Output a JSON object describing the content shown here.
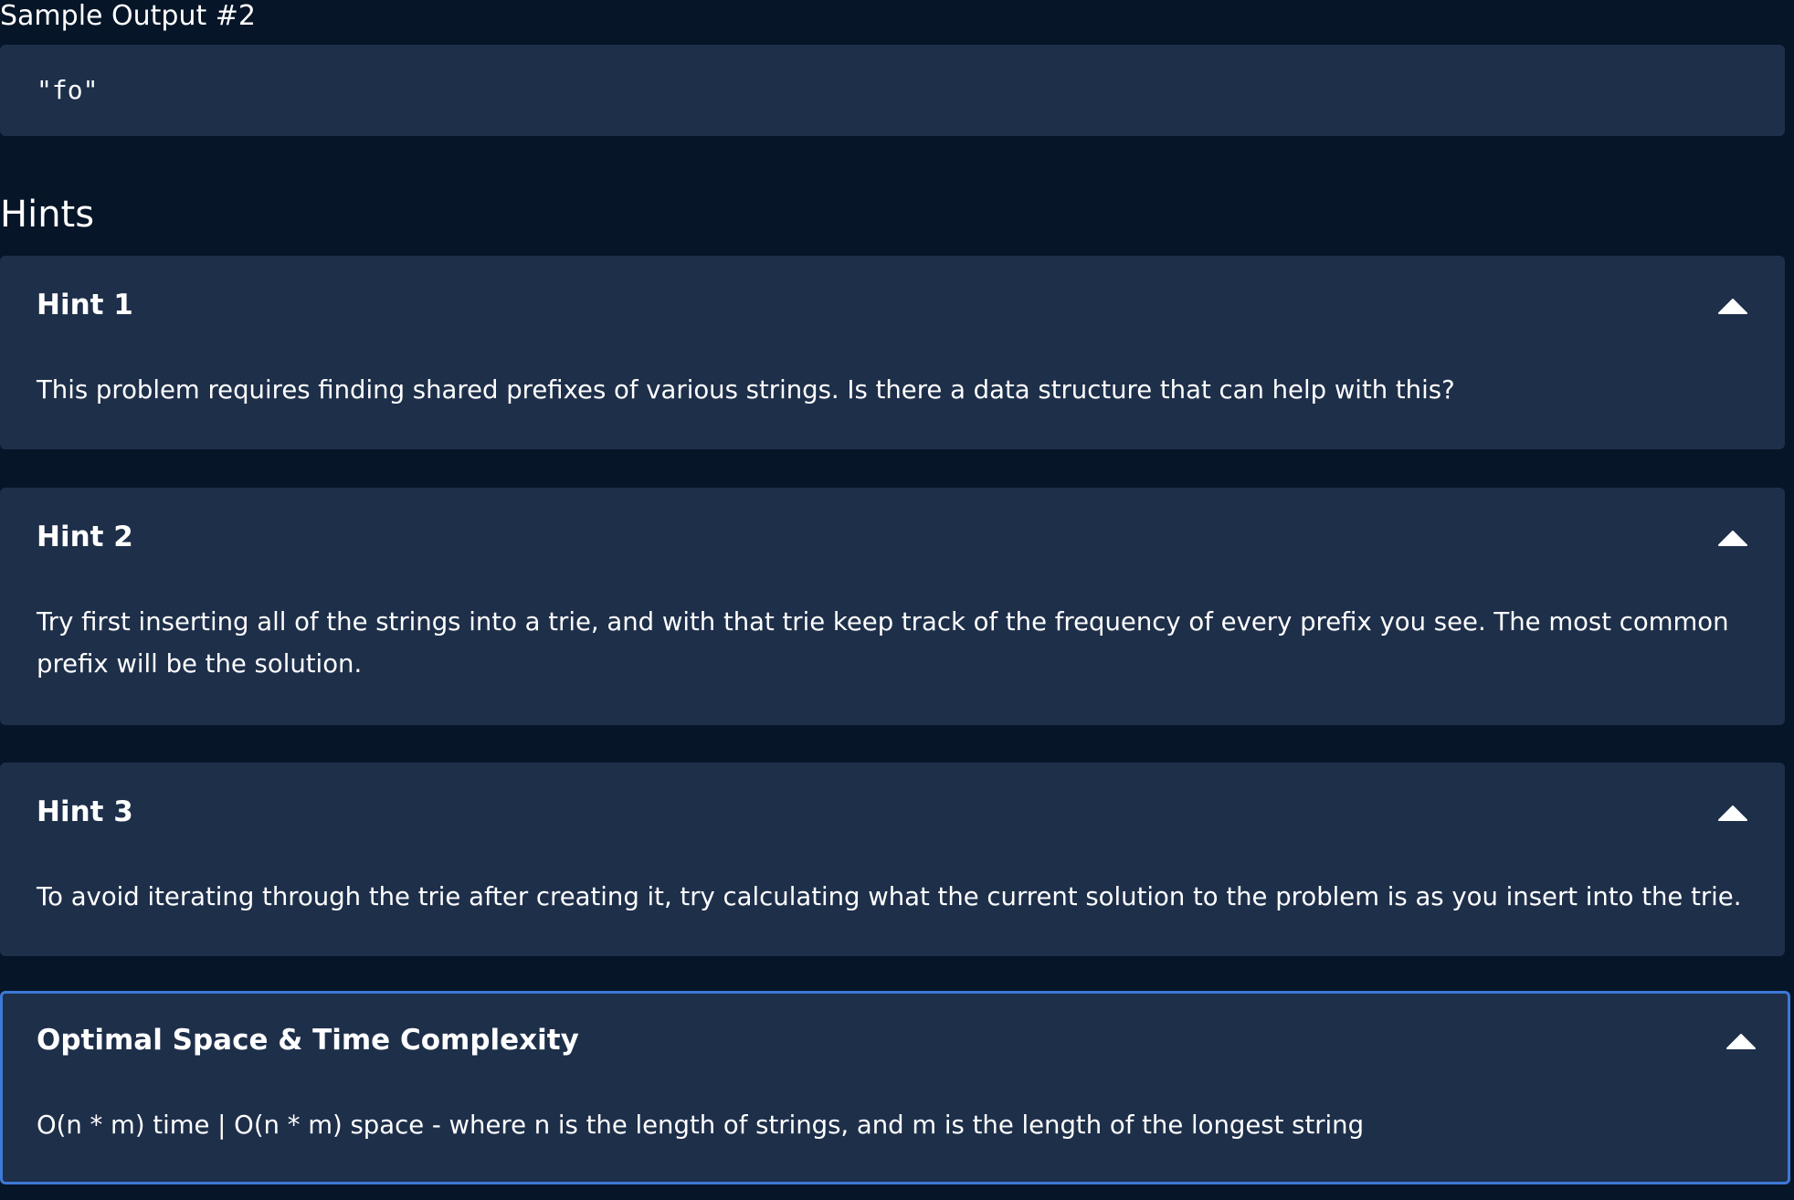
{
  "sample_output": {
    "title": "Sample Output #2",
    "code": "\"fo\""
  },
  "hints_heading": "Hints",
  "hints": [
    {
      "title": "Hint 1",
      "body": "This problem requires finding shared prefixes of various strings. Is there a data structure that can help with this?"
    },
    {
      "title": "Hint 2",
      "body": "Try first inserting all of the strings into a trie, and with that trie keep track of the frequency of every prefix you see. The most common prefix will be the solution."
    },
    {
      "title": "Hint 3",
      "body": "To avoid iterating through the trie after creating it, try calculating what the current solution to the problem is as you insert into the trie."
    }
  ],
  "complexity": {
    "title": "Optimal Space & Time Complexity",
    "body": "O(n * m) time | O(n * m) space - where n is the length of strings, and m is the length of the longest string"
  },
  "icons": {
    "collapse": "chevron-up-icon"
  },
  "colors": {
    "page_background": "#061528",
    "card_background": "#1e2f4a",
    "active_border": "#3d79d6",
    "text": "#ffffff"
  }
}
